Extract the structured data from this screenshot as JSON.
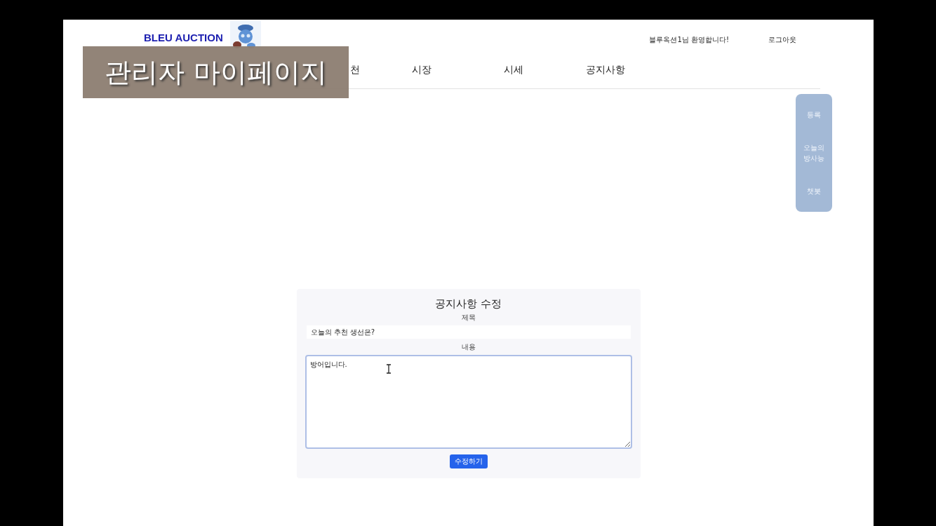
{
  "header": {
    "logo": "BLEU AUCTION",
    "welcome": "블루옥션1님 환영합니다!",
    "logout": "로그아웃"
  },
  "nav": [
    {
      "label": "천"
    },
    {
      "label": "시장"
    },
    {
      "label": "시세"
    },
    {
      "label": "공지사항"
    }
  ],
  "side_menu": [
    "등록",
    "오늘의 방사능",
    "챗봇"
  ],
  "form": {
    "title": "공지사항 수정",
    "title_label": "제목",
    "title_value": "오늘의 추천 생선은?",
    "content_label": "내용",
    "content_value": "방어입니다.",
    "submit": "수정하기"
  },
  "caption": "관리자 마이페이지"
}
